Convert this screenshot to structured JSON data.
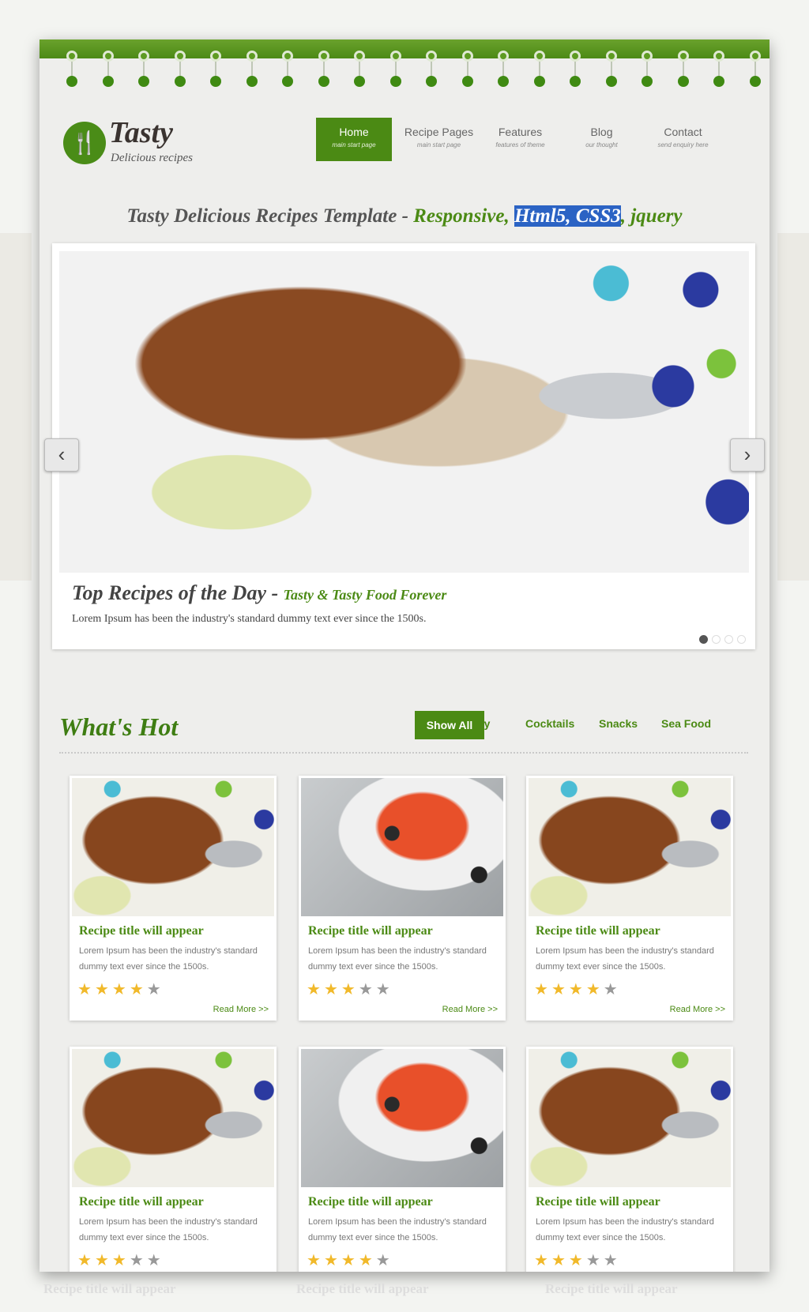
{
  "brand": {
    "name": "Tasty",
    "tagline": "Delicious recipes"
  },
  "nav": [
    {
      "label": "Home",
      "sub": "main start page",
      "active": true
    },
    {
      "label": "Recipe Pages",
      "sub": "main start page"
    },
    {
      "label": "Features",
      "sub": "features of theme"
    },
    {
      "label": "Blog",
      "sub": "our thought"
    },
    {
      "label": "Contact",
      "sub": "send enquiry here"
    }
  ],
  "headline": {
    "main": "Tasty Delicious Recipes Template - ",
    "green1": "Responsive, ",
    "highlight": "Html5, CSS3",
    "green2": ", jquery"
  },
  "slider": {
    "title": "Top Recipes of the Day - ",
    "subtitle": "Tasty & Tasty Food Forever",
    "text": "Lorem Ipsum has been the industry's standard dummy text ever since the 1500s.",
    "slide_count": 4,
    "active_slide": 1,
    "prev": "‹",
    "next": "›"
  },
  "hot": {
    "title": "What's Hot",
    "tabs": {
      "active": "Show All",
      "hidden": "Spicy",
      "others": [
        "Cocktails",
        "Snacks",
        "Sea Food"
      ]
    }
  },
  "cards": [
    {
      "title": "Recipe title will appear",
      "text": "Lorem Ipsum has been the industry's standard dummy text ever since the 1500s.",
      "rating": 4,
      "link": "Read More >>",
      "image": "meat"
    },
    {
      "title": "Recipe title will appear",
      "text": "Lorem Ipsum has been the industry's standard dummy text ever since the 1500s.",
      "rating": 3,
      "link": "Read More >>",
      "image": "salad"
    },
    {
      "title": "Recipe title will appear",
      "text": "Lorem Ipsum has been the industry's standard dummy text ever since the 1500s.",
      "rating": 4,
      "link": "Read More >>",
      "image": "meat"
    },
    {
      "title": "Recipe title will appear",
      "text": "Lorem Ipsum has been the industry's standard dummy text ever since the 1500s.",
      "rating": 3,
      "image": "meat"
    },
    {
      "title": "Recipe title will appear",
      "text": "Lorem Ipsum has been the industry's standard dummy text ever since the 1500s.",
      "rating": 4,
      "image": "salad"
    },
    {
      "title": "Recipe title will appear",
      "text": "Lorem Ipsum has been the industry's standard dummy text ever since the 1500s.",
      "rating": 3,
      "image": "meat"
    }
  ],
  "colors": {
    "brand_green": "#4b8a14",
    "highlight": "#2b63c4",
    "star": "#f1b92a"
  }
}
